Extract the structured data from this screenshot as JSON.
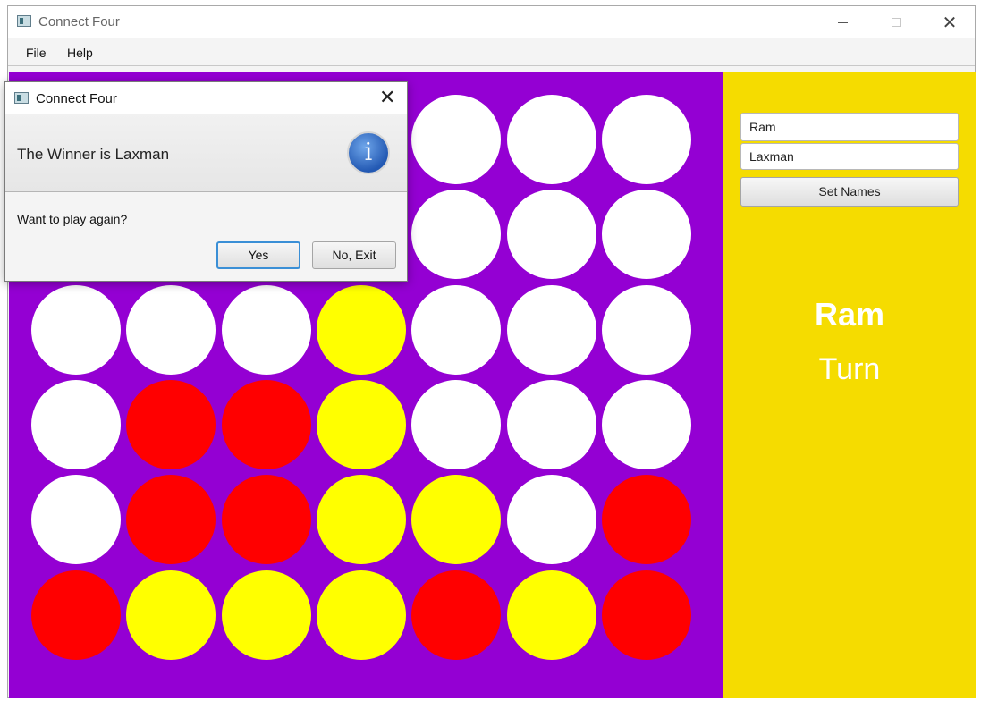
{
  "window": {
    "title": "Connect Four",
    "minimize_icon": "minimize-icon",
    "maximize_icon": "maximize-icon",
    "close_glyph": "✕"
  },
  "menu": {
    "items": [
      "File",
      "Help"
    ]
  },
  "colors": {
    "board": "#9400d3",
    "panel": "#f5dc00",
    "empty": "#ffffff",
    "red": "#ff0000",
    "yellow": "#ffff00"
  },
  "board": {
    "rows": [
      [
        "empty",
        "empty",
        "empty",
        "empty",
        "empty",
        "empty",
        "empty"
      ],
      [
        "empty",
        "empty",
        "empty",
        "empty",
        "empty",
        "empty",
        "empty"
      ],
      [
        "empty",
        "empty",
        "empty",
        "yellow",
        "empty",
        "empty",
        "empty"
      ],
      [
        "empty",
        "red",
        "red",
        "yellow",
        "empty",
        "empty",
        "empty"
      ],
      [
        "empty",
        "red",
        "red",
        "yellow",
        "yellow",
        "empty",
        "red"
      ],
      [
        "red",
        "yellow",
        "yellow",
        "yellow",
        "red",
        "yellow",
        "red"
      ]
    ]
  },
  "side_panel": {
    "player_one": "Ram",
    "player_two": "Laxman",
    "set_names_label": "Set Names",
    "current_player": "Ram",
    "turn_label": "Turn"
  },
  "dialog": {
    "title": "Connect Four",
    "close_glyph": "✕",
    "header_text": "The Winner is Laxman",
    "info_icon": "information-icon",
    "info_glyph": "i",
    "content_text": "Want to play again?",
    "yes_label": "Yes",
    "no_label": "No, Exit"
  }
}
